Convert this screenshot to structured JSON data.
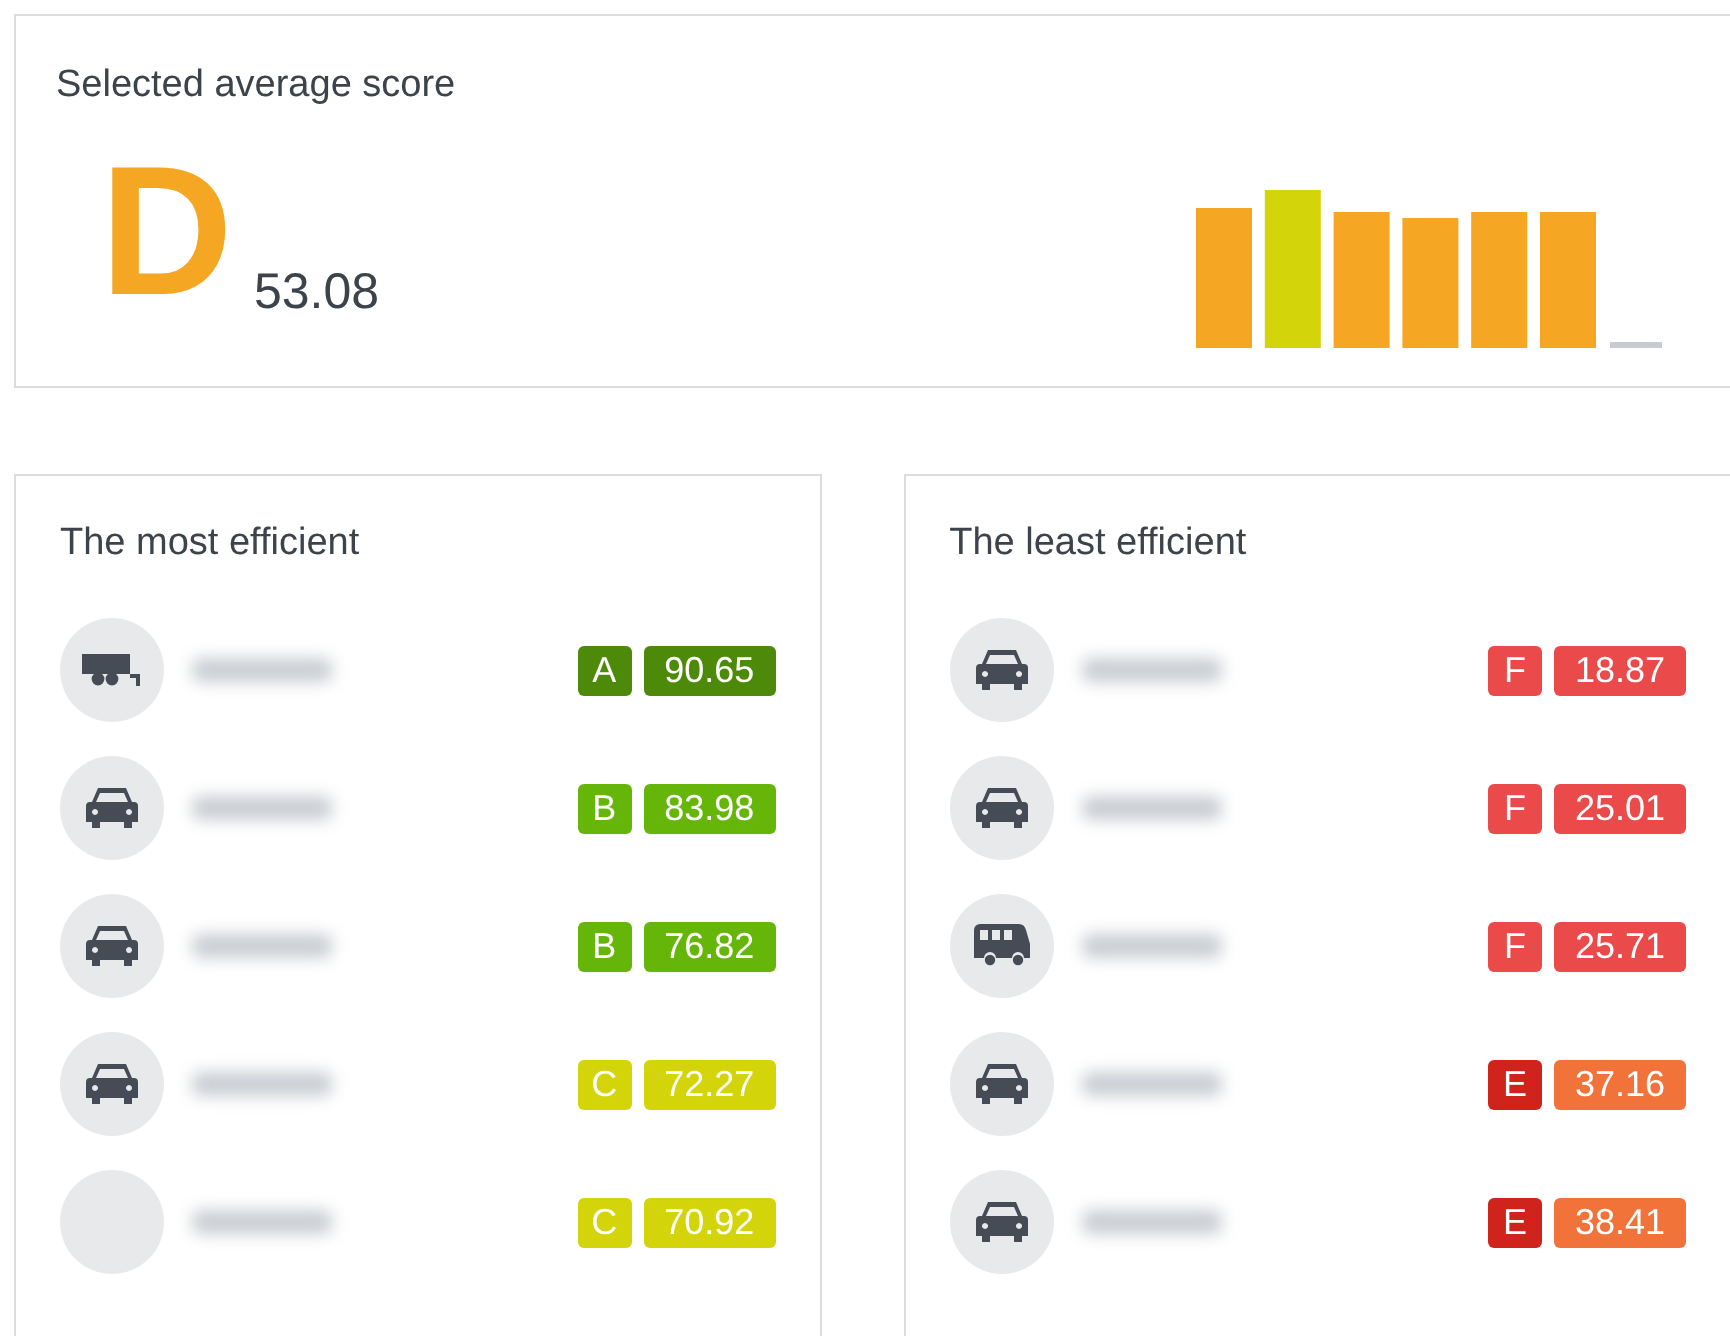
{
  "score_card": {
    "title": "Selected average score",
    "grade": "D",
    "score": "53.08"
  },
  "most_efficient": {
    "title": "The most efficient",
    "rows": [
      {
        "kind": "trailer",
        "grade": {
          "label": "A",
          "color": "#4e8a0a"
        },
        "score": {
          "label": "90.65",
          "color": "#4e8a0a"
        }
      },
      {
        "kind": "car",
        "grade": {
          "label": "B",
          "color": "#66b60a"
        },
        "score": {
          "label": "83.98",
          "color": "#66b60a"
        }
      },
      {
        "kind": "car",
        "grade": {
          "label": "B",
          "color": "#66b60a"
        },
        "score": {
          "label": "76.82",
          "color": "#66b60a"
        }
      },
      {
        "kind": "car",
        "grade": {
          "label": "C",
          "color": "#d4d40a"
        },
        "score": {
          "label": "72.27",
          "color": "#d4d40a"
        }
      },
      {
        "kind": "none",
        "grade": {
          "label": "C",
          "color": "#d4d40a"
        },
        "score": {
          "label": "70.92",
          "color": "#d4d40a"
        }
      }
    ]
  },
  "least_efficient": {
    "title": "The least efficient",
    "rows": [
      {
        "kind": "car",
        "grade": {
          "label": "F",
          "color": "#ea4a4a"
        },
        "score": {
          "label": "18.87",
          "color": "#ea4a4a"
        }
      },
      {
        "kind": "car",
        "grade": {
          "label": "F",
          "color": "#ea4a4a"
        },
        "score": {
          "label": "25.01",
          "color": "#ea4a4a"
        }
      },
      {
        "kind": "bus",
        "grade": {
          "label": "F",
          "color": "#ea4a4a"
        },
        "score": {
          "label": "25.71",
          "color": "#ea4a4a"
        }
      },
      {
        "kind": "car",
        "grade": {
          "label": "E",
          "color": "#d0231c"
        },
        "score": {
          "label": "37.16",
          "color": "#f2733a"
        }
      },
      {
        "kind": "car",
        "grade": {
          "label": "E",
          "color": "#d0231c"
        },
        "score": {
          "label": "38.41",
          "color": "#f2733a"
        }
      }
    ]
  }
}
